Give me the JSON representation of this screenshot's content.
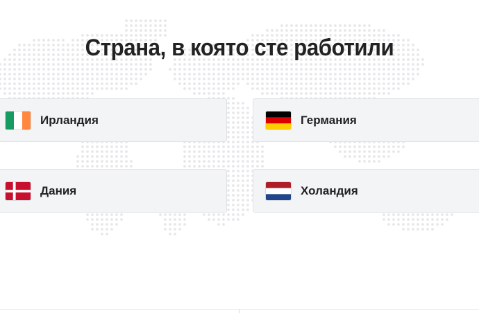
{
  "title": "Страна, в която сте работили",
  "countries": [
    {
      "label": "Ирландия",
      "flag": "ireland-flag-icon",
      "colors": [
        "#169b62",
        "#ffffff",
        "#ff883e"
      ]
    },
    {
      "label": "Германия",
      "flag": "germany-flag-icon",
      "colors": [
        "#000000",
        "#dd0000",
        "#ffce00"
      ]
    },
    {
      "label": "Дания",
      "flag": "denmark-flag-icon",
      "colors": [
        "#c8102e",
        "#ffffff"
      ]
    },
    {
      "label": "Холандия",
      "flag": "netherlands-flag-icon",
      "colors": [
        "#ae1c28",
        "#ffffff",
        "#21468b"
      ]
    }
  ],
  "colors": {
    "card_background": "#f2f4f6",
    "card_border": "#e0e3e7",
    "text": "#222222",
    "map_dots": "#e6e7e9"
  }
}
